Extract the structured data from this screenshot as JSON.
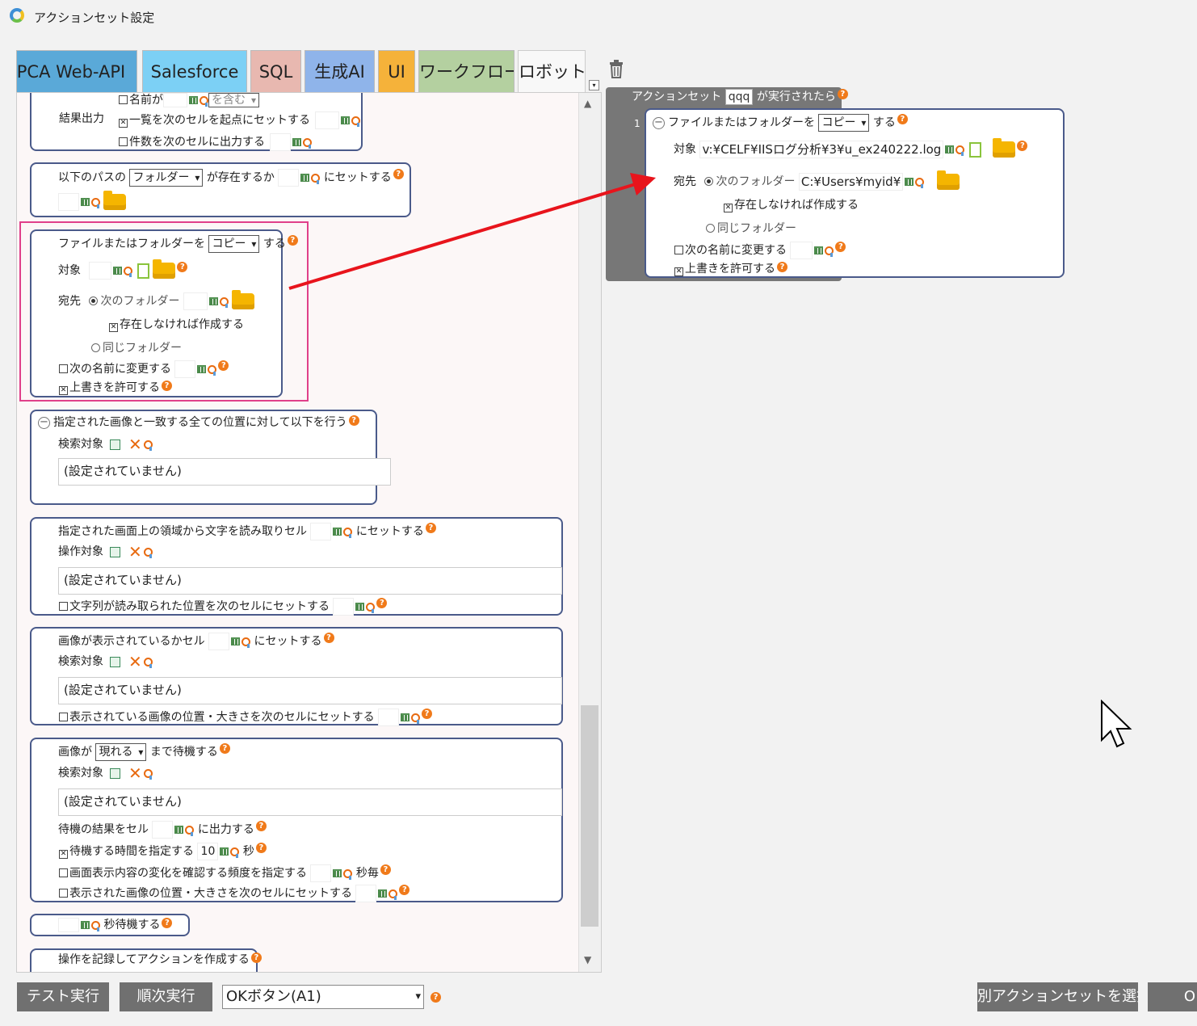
{
  "window": {
    "title": "アクションセット設定"
  },
  "tabs": [
    {
      "label": "PCA Web-API",
      "color": "#5aa9d8"
    },
    {
      "label": "Salesforce",
      "color": "#7cd0f5"
    },
    {
      "label": "SQL",
      "color": "#e8b8b0"
    },
    {
      "label": "生成AI",
      "color": "#8fb4ea"
    },
    {
      "label": "UI",
      "color": "#f5b23a"
    },
    {
      "label": "ワークフロー",
      "color": "#b4d0a0"
    },
    {
      "label": "ロボット",
      "color": "#f8f8f8"
    }
  ],
  "left": {
    "b1": {
      "row0": "名前が",
      "sel0": "を含む",
      "label": "結果出力",
      "opt1": "一覧を次のセルを起点にセットする",
      "opt2": "件数を次のセルに出力する"
    },
    "b2": {
      "pre": "以下のパスの",
      "sel": "フォルダー",
      "mid": "が存在するか",
      "post": "にセットする"
    },
    "b3": {
      "pre": "ファイルまたはフォルダーを",
      "sel": "コピー",
      "post": "する",
      "target": "対象",
      "dest": "宛先",
      "radio1": "次のフォルダー",
      "create": "存在しなければ作成する",
      "radio2": "同じフォルダー",
      "rename": "次の名前に変更する",
      "overwrite": "上書きを許可する"
    },
    "b4": {
      "title": "指定された画像と一致する全ての位置に対して以下を行う",
      "search": "検索対象",
      "empty": "(設定されていません)"
    },
    "b5": {
      "pre": "指定された画面上の領域から文字を読み取りセル",
      "post": "にセットする",
      "op": "操作対象",
      "empty": "(設定されていません)",
      "opt": "文字列が読み取られた位置を次のセルにセットする"
    },
    "b6": {
      "pre": "画像が表示されているかセル",
      "post": "にセットする",
      "search": "検索対象",
      "empty": "(設定されていません)",
      "opt": "表示されている画像の位置・大きさを次のセルにセットする"
    },
    "b7": {
      "pre": "画像が",
      "sel": "現れる",
      "post": "まで待機する",
      "search": "検索対象",
      "empty": "(設定されていません)",
      "res_pre": "待機の結果をセル",
      "res_post": "に出力する",
      "wait": "待機する時間を指定する",
      "wait_val": "10",
      "sec": "秒",
      "freq": "画面表示内容の変化を確認する頻度を指定する",
      "per_sec": "秒毎",
      "opt": "表示された画像の位置・大きさを次のセルにセットする"
    },
    "b8": {
      "post": "秒待機する"
    },
    "b9": {
      "title": "操作を記録してアクションを作成する"
    }
  },
  "right": {
    "header_pre": "アクションセット",
    "header_name": "qqq",
    "header_post": "が実行されたら",
    "line_no": "1",
    "pre": "ファイルまたはフォルダーを",
    "sel": "コピー",
    "post": "する",
    "target": "対象",
    "target_val": "v:¥CELF¥IISログ分析¥3¥u_ex240222.log",
    "dest": "宛先",
    "radio1": "次のフォルダー",
    "dest_val": "C:¥Users¥myid¥",
    "create": "存在しなければ作成する",
    "radio2": "同じフォルダー",
    "rename": "次の名前に変更する",
    "overwrite": "上書きを許可する"
  },
  "bottom": {
    "test_run": "テスト実行",
    "seq_run": "順次実行",
    "button_select": "OKボタン(A1)",
    "other_set": "別アクションセットを選択",
    "ok": "O"
  },
  "colors": {
    "highlight": "#e0408a",
    "arrow": "#e8141c",
    "block_border": "#4a5a8a",
    "help": "#f07a1a"
  }
}
